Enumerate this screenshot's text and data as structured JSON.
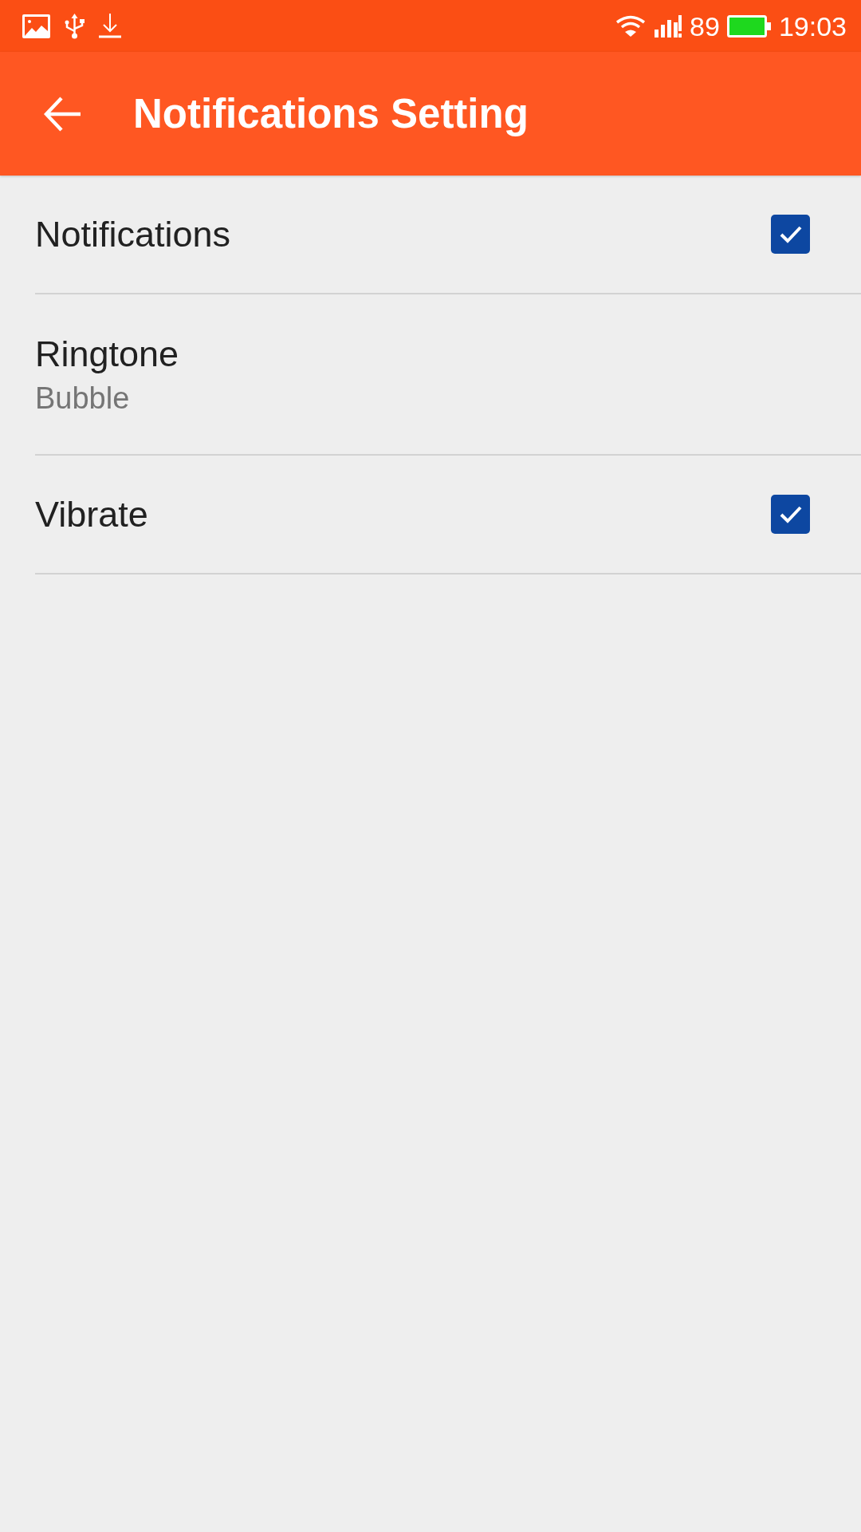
{
  "status_bar": {
    "battery_text": "89",
    "time": "19:03"
  },
  "app_bar": {
    "title": "Notifications Setting"
  },
  "settings": [
    {
      "kind": "checkbox",
      "title": "Notifications",
      "checked": true
    },
    {
      "kind": "value",
      "title": "Ringtone",
      "summary": "Bubble"
    },
    {
      "kind": "checkbox",
      "title": "Vibrate",
      "checked": true
    }
  ]
}
